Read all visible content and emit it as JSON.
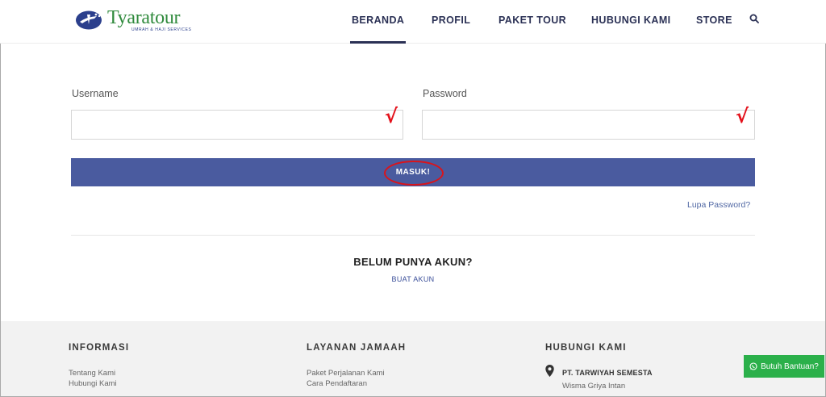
{
  "header": {
    "logo": {
      "name": "Tyaratour",
      "tagline": "UMRAH & HAJI SERVICES"
    },
    "nav": [
      {
        "label": "BERANDA",
        "active": true
      },
      {
        "label": "PROFIL",
        "active": false
      },
      {
        "label": "PAKET TOUR",
        "active": false
      },
      {
        "label": "HUBUNGI KAMI",
        "active": false
      },
      {
        "label": "STORE",
        "active": false
      }
    ],
    "search_icon": "search-icon"
  },
  "form": {
    "username_label": "Username",
    "username_value": "",
    "password_label": "Password",
    "password_value": "",
    "check_mark": "√",
    "submit_label": "MASUK!",
    "forgot_label": "Lupa Password?"
  },
  "signup": {
    "heading": "BELUM PUNYA AKUN?",
    "link_label": "BUAT AKUN"
  },
  "footer": {
    "columns": [
      {
        "heading": "INFORMASI",
        "links": [
          "Tentang Kami",
          "Hubungi Kami"
        ]
      },
      {
        "heading": "LAYANAN JAMAAH",
        "links": [
          "Paket Perjalanan Kami",
          "Cara Pendaftaran"
        ]
      },
      {
        "heading": "HUBUNGI KAMI",
        "company": "PT. TARWIYAH SEMESTA",
        "address": "Wisma Griya Intan"
      }
    ],
    "help_button": "Butuh Bantuan?"
  },
  "colors": {
    "brand_green": "#2f8a3c",
    "nav_text": "#2b3155",
    "button_blue": "#4a5b9f",
    "annotation_red": "#e3111b",
    "help_green": "#2bb04a"
  }
}
